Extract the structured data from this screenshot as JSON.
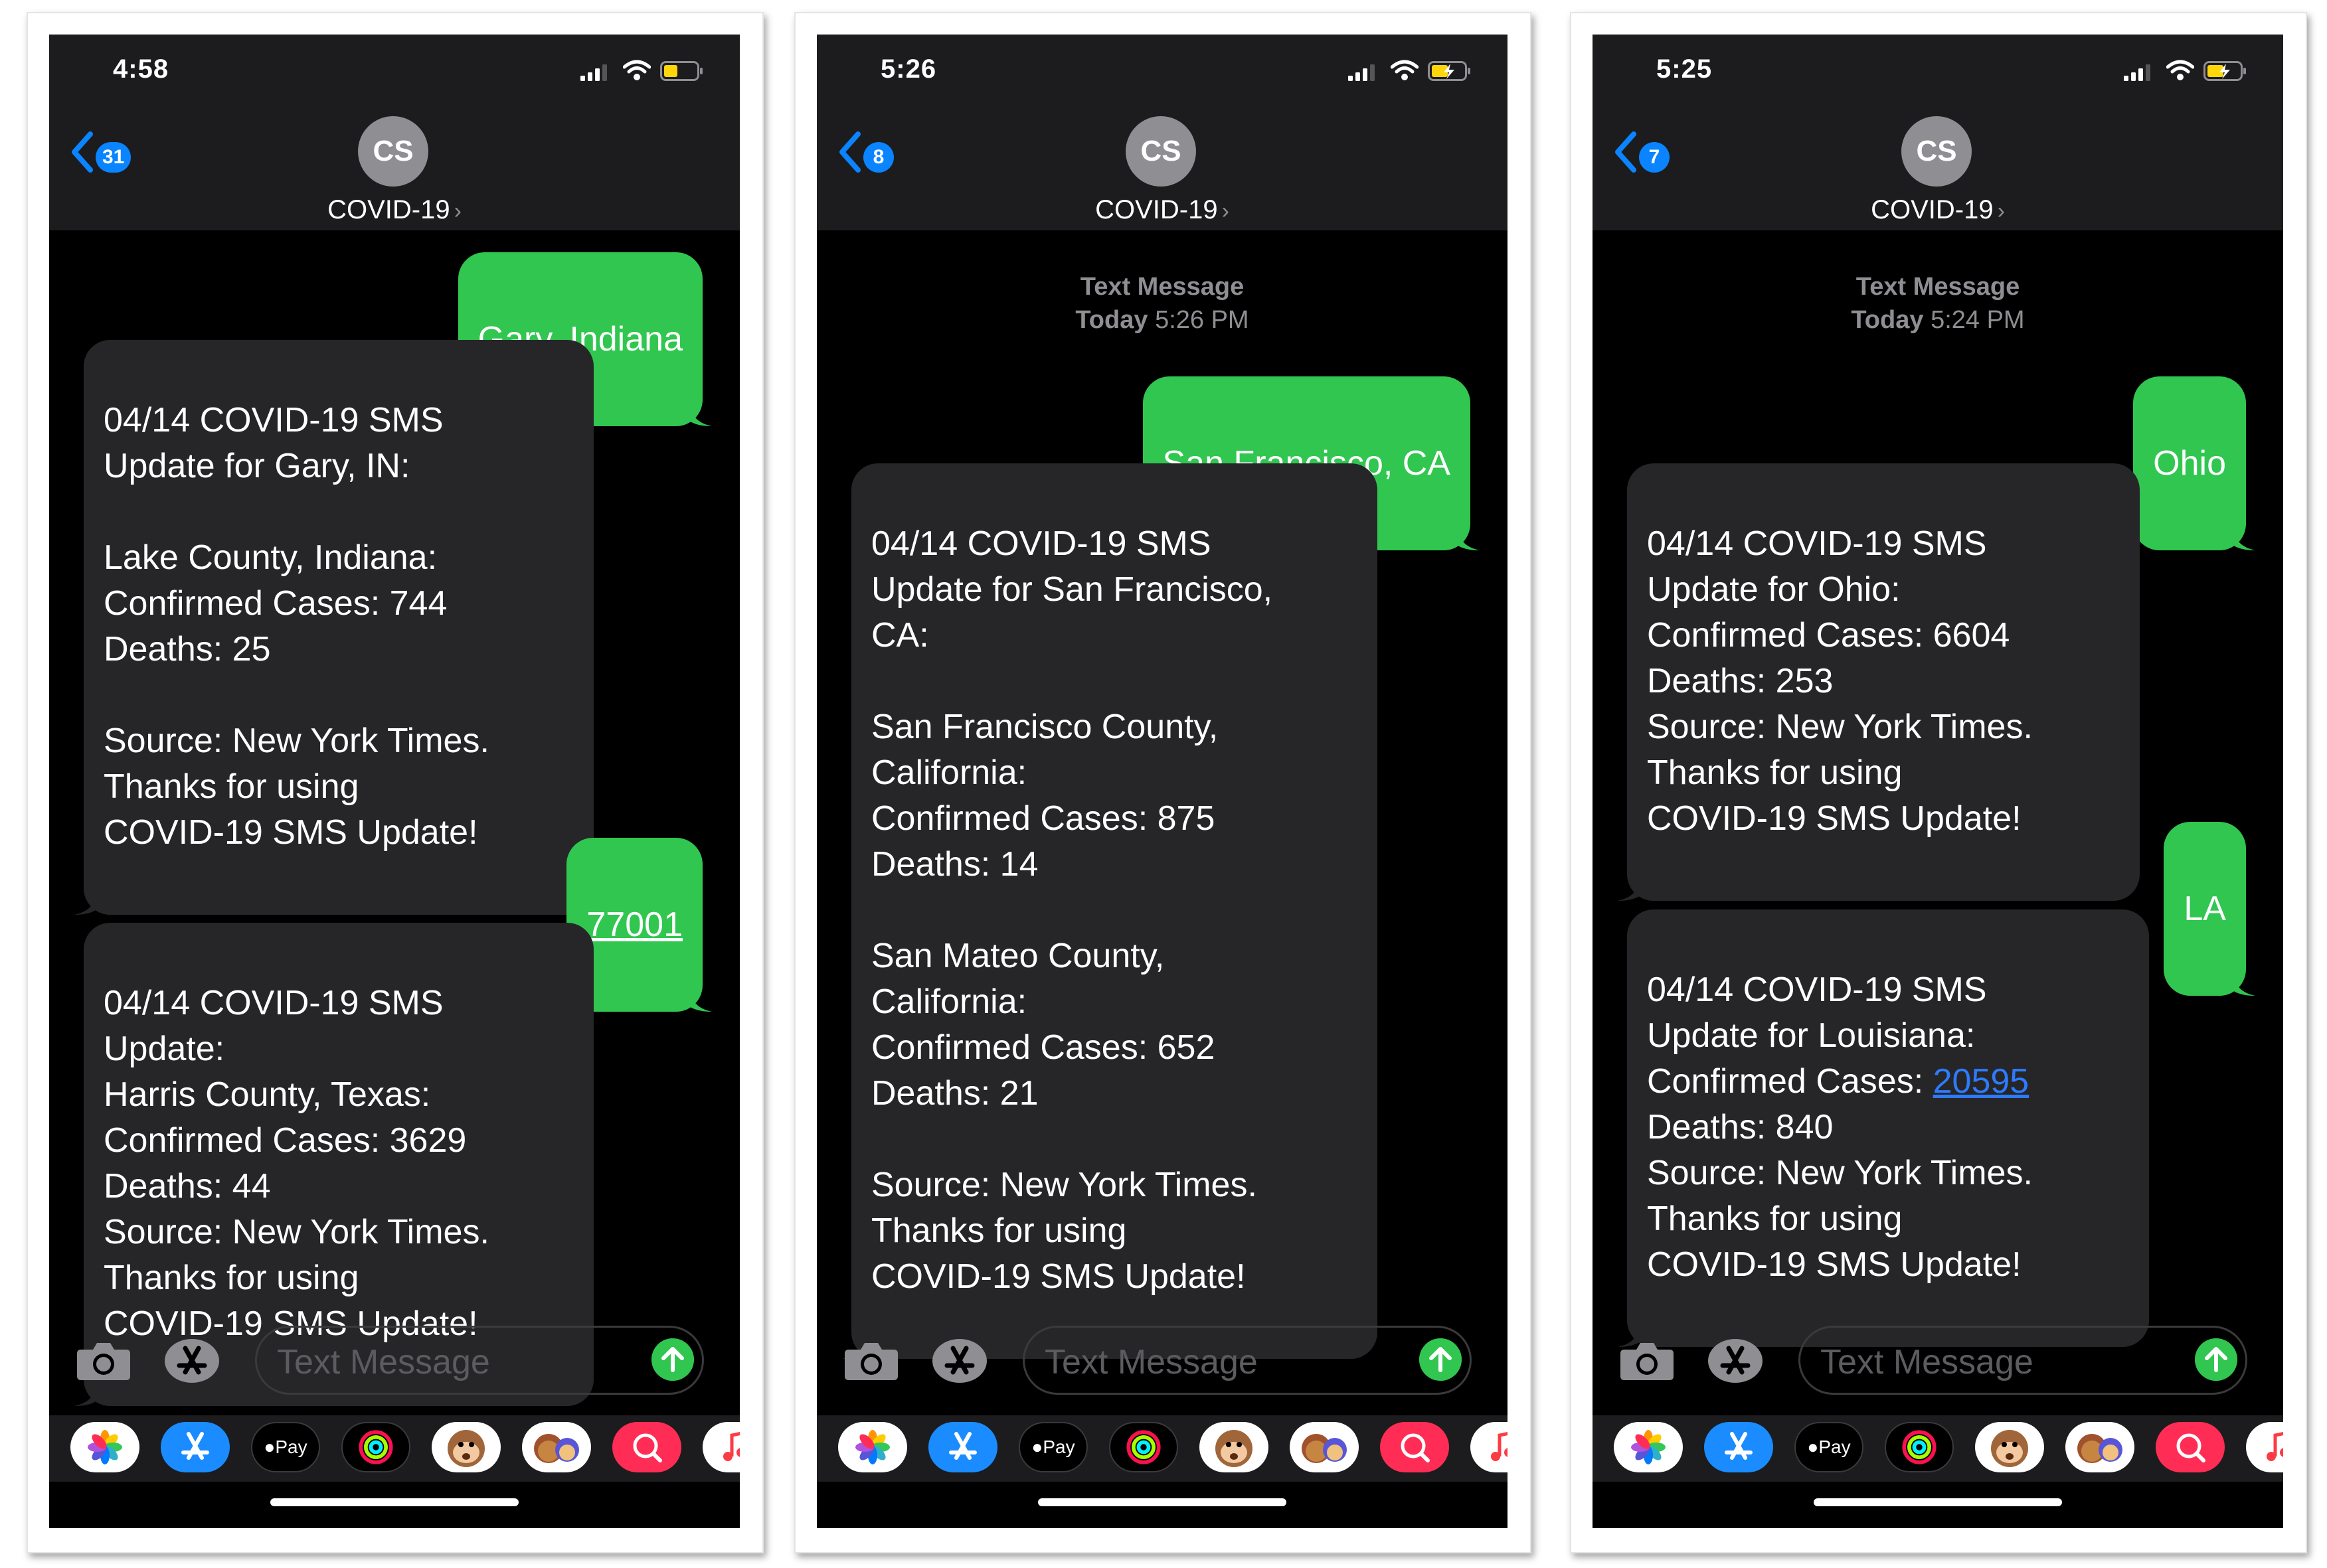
{
  "screens": [
    {
      "status": {
        "time": "4:58"
      },
      "nav": {
        "back_count": "31",
        "avatar_initials": "CS",
        "contact_name": "COVID-19",
        "chevron": "›"
      },
      "messages": {
        "m1": "Gary, Indiana",
        "m2": "04/14 COVID-19 SMS\nUpdate for Gary, IN:\n\nLake County, Indiana:\nConfirmed Cases: 744\nDeaths: 25\n\nSource: New York Times.\nThanks for using\nCOVID-19 SMS Update!",
        "m3": "77001",
        "m4": "04/14 COVID-19 SMS\nUpdate:\nHarris County, Texas:\nConfirmed Cases: 3629\nDeaths: 44\nSource: New York Times.\nThanks for using\nCOVID-19 SMS Update!"
      },
      "input": {
        "placeholder": "Text Message"
      },
      "apps": {
        "applepay": "Pay"
      }
    },
    {
      "status": {
        "time": "5:26"
      },
      "nav": {
        "back_count": "8",
        "avatar_initials": "CS",
        "contact_name": "COVID-19",
        "chevron": "›"
      },
      "stamp": {
        "title": "Text Message",
        "day": "Today",
        "time": "5:26 PM"
      },
      "messages": {
        "m1": "San Francisco, CA",
        "m2": "04/14 COVID-19 SMS\nUpdate for San Francisco,\nCA:\n\nSan Francisco County,\nCalifornia:\nConfirmed Cases: 875\nDeaths: 14\n\nSan Mateo County,\nCalifornia:\nConfirmed Cases: 652\nDeaths: 21\n\nSource: New York Times.\nThanks for using\nCOVID-19 SMS Update!"
      },
      "input": {
        "placeholder": "Text Message"
      },
      "apps": {
        "applepay": "Pay"
      }
    },
    {
      "status": {
        "time": "5:25"
      },
      "nav": {
        "back_count": "7",
        "avatar_initials": "CS",
        "contact_name": "COVID-19",
        "chevron": "›"
      },
      "stamp": {
        "title": "Text Message",
        "day": "Today",
        "time": "5:24 PM"
      },
      "messages": {
        "m1": "Ohio",
        "m2": "04/14 COVID-19 SMS\nUpdate for Ohio:\nConfirmed Cases: 6604\nDeaths: 253\nSource: New York Times.\nThanks for using\nCOVID-19 SMS Update!",
        "m3": "LA",
        "m4a": "04/14 COVID-19 SMS\nUpdate for Louisiana:\nConfirmed Cases: ",
        "m4link": "20595",
        "m4b": "\nDeaths: 840\nSource: New York Times.\nThanks for using\nCOVID-19 SMS Update!"
      },
      "input": {
        "placeholder": "Text Message"
      },
      "apps": {
        "applepay": "Pay"
      }
    }
  ],
  "colors": {
    "imessage_green": "#31c650",
    "incoming_bubble": "#262628",
    "header_bg": "#1c1c1e",
    "link_blue": "#2d7bff",
    "badge_blue": "#0a84ff"
  },
  "icons": [
    "signal-icon",
    "wifi-icon",
    "battery-icon",
    "back-chevron-icon",
    "camera-icon",
    "app-store-icon",
    "send-arrow-icon",
    "photos-app-icon",
    "apple-pay-icon",
    "activity-icon",
    "animoji-icon",
    "memoji-icon",
    "search-images-icon",
    "music-icon"
  ]
}
